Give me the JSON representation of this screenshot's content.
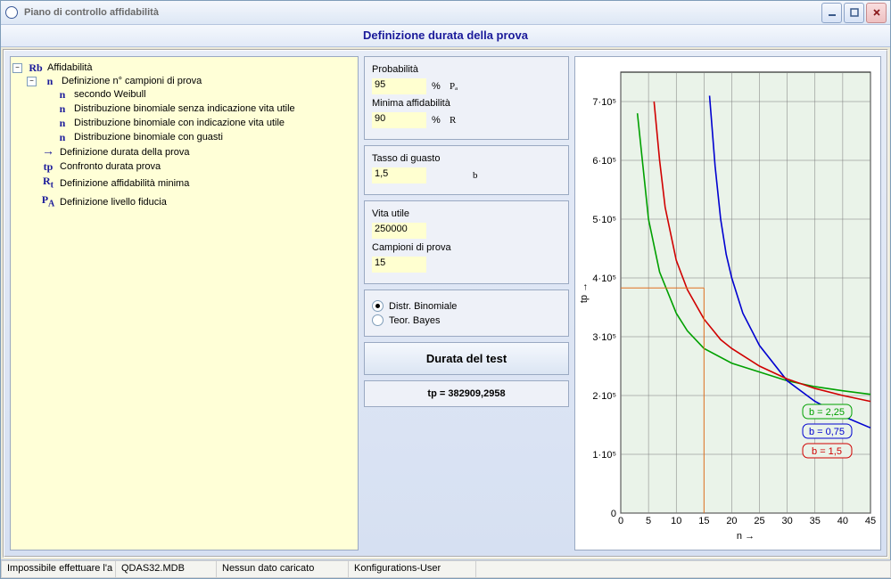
{
  "window": {
    "title": "Piano di controllo affidabilità"
  },
  "header": "Definizione durata della prova",
  "tree": {
    "root": "Affidabilità",
    "n_group": "Definizione n° campioni di prova",
    "n_items": [
      "secondo Weibull",
      "Distribuzione binomiale senza indicazione vita utile",
      "Distribuzione binomiale con indicazione vita utile",
      "Distribuzione binomiale con guasti"
    ],
    "arrow_item": "Definizione durata della prova",
    "tp_item": "Confronto durata prova",
    "rt_item": "Definizione affidabilità minima",
    "pa_item": "Definizione livello fiducia"
  },
  "form": {
    "prob_label": "Probabilità",
    "prob_value": "95",
    "prob_unit": "%",
    "prob_symbol": "Pₐ",
    "minrel_label": "Minima affidabilità",
    "minrel_value": "90",
    "minrel_unit": "%",
    "minrel_symbol": "R",
    "fail_label": "Tasso di guasto",
    "fail_value": "1,5",
    "fail_symbol": "b",
    "life_label": "Vita utile",
    "life_value": "250000",
    "samples_label": "Campioni di prova",
    "samples_value": "15",
    "radio1": "Distr. Binomiale",
    "radio2": "Teor. Bayes",
    "button": "Durata del test",
    "result": "tp = 382909,2958"
  },
  "status": [
    "Impossibile effettuare l'a",
    "QDAS32.MDB",
    "Nessun dato caricato",
    "Konfigurations-User",
    ""
  ],
  "chart_data": {
    "type": "line",
    "xlabel": "n →",
    "ylabel": "tp →",
    "xlim": [
      0,
      45
    ],
    "ylim": [
      0,
      750000
    ],
    "xticks": [
      0,
      5,
      10,
      15,
      20,
      25,
      30,
      35,
      40,
      45
    ],
    "yticks": [
      0,
      100000,
      200000,
      300000,
      400000,
      500000,
      600000,
      700000
    ],
    "ytick_labels": [
      "0",
      "1·10⁵",
      "2·10⁵",
      "3·10⁵",
      "4·10⁵",
      "5·10⁵",
      "6·10⁵",
      "7·10⁵"
    ],
    "series": [
      {
        "name": "b = 2,25",
        "color": "#00a000",
        "x": [
          3,
          5,
          7,
          10,
          12,
          15,
          20,
          25,
          30,
          35,
          40,
          45
        ],
        "y": [
          680000,
          500000,
          410000,
          340000,
          310000,
          280000,
          255000,
          240000,
          225000,
          215000,
          208000,
          202000
        ]
      },
      {
        "name": "b = 0,75",
        "color": "#0000d0",
        "x": [
          16,
          17,
          18,
          19,
          20,
          22,
          25,
          30,
          35,
          40,
          45
        ],
        "y": [
          710000,
          590000,
          500000,
          440000,
          400000,
          340000,
          285000,
          225000,
          190000,
          165000,
          145000
        ]
      },
      {
        "name": "b = 1,5",
        "color": "#d00000",
        "x": [
          6,
          7,
          8,
          10,
          12,
          15,
          18,
          20,
          25,
          30,
          35,
          40,
          45
        ],
        "y": [
          700000,
          600000,
          520000,
          430000,
          380000,
          330000,
          295000,
          280000,
          250000,
          228000,
          212000,
          200000,
          190000
        ]
      }
    ],
    "legend": [
      {
        "label": "b = 2,25",
        "color": "#00a000"
      },
      {
        "label": "b = 0,75",
        "color": "#0000d0"
      },
      {
        "label": "b = 1,5",
        "color": "#d00000"
      }
    ],
    "marker": {
      "x": 15,
      "y": 382909
    }
  }
}
